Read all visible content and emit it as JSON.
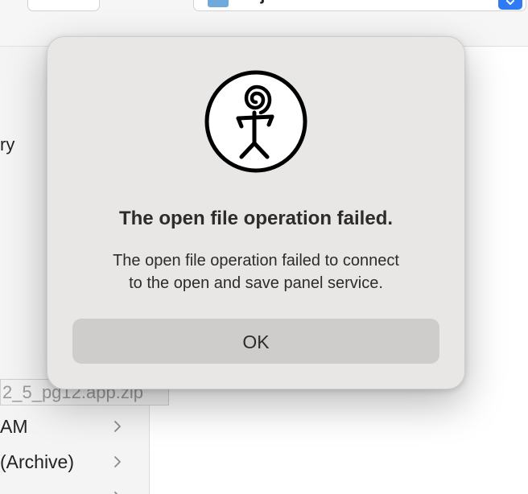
{
  "toolbar": {
    "location_label": "adj"
  },
  "sidebar": {
    "partial_item": "ry"
  },
  "tooltip": {
    "filename": "2_5_pg12.app.zip"
  },
  "file_list": [
    {
      "label": "AM"
    },
    {
      "label": "(Archive)"
    },
    {
      "label": ""
    }
  ],
  "alert": {
    "icon": "stick-figure-spiral-icon",
    "title": "The open file operation failed.",
    "message_line1": "The open file operation failed to connect",
    "message_line2": "to the open and save panel service.",
    "ok_label": "OK"
  },
  "colors": {
    "accent": "#2f7bf6",
    "dialog_bg": "#e9e7e5",
    "button_bg": "#cfcdcb"
  }
}
